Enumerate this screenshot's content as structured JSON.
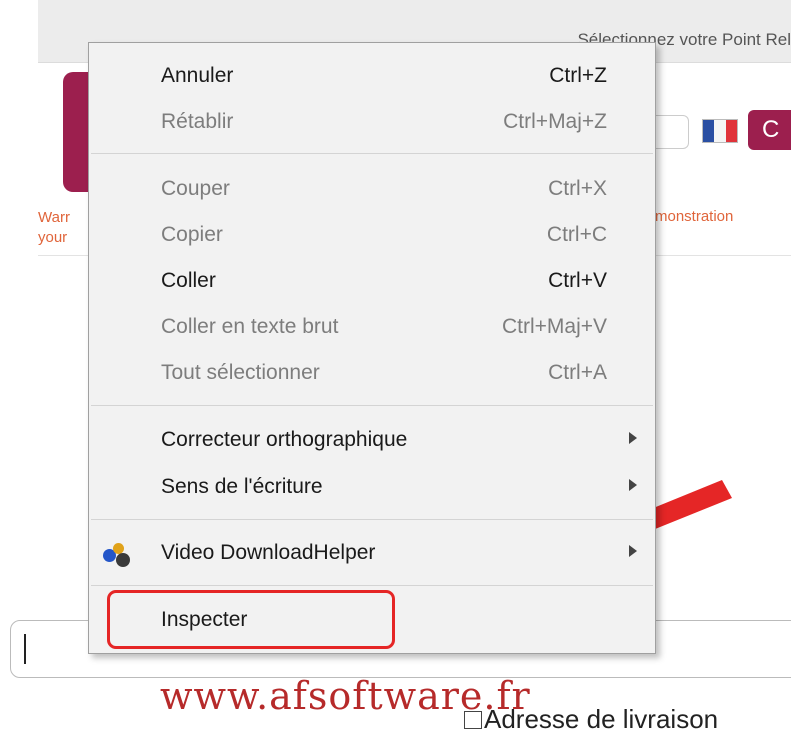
{
  "background_page": {
    "relay_header": "Sélectionnez votre Point Rel",
    "button_letter": "C",
    "warning_left": "Warr your",
    "warning_right": "monstration",
    "watermark": "www.afsoftware.fr",
    "delivery_checkbox_label": "Adresse de livraison"
  },
  "context_menu": {
    "undo": {
      "label": "Annuler",
      "shortcut": "Ctrl+Z"
    },
    "redo": {
      "label": "Rétablir",
      "shortcut": "Ctrl+Maj+Z"
    },
    "cut": {
      "label": "Couper",
      "shortcut": "Ctrl+X"
    },
    "copy": {
      "label": "Copier",
      "shortcut": "Ctrl+C"
    },
    "paste": {
      "label": "Coller",
      "shortcut": "Ctrl+V"
    },
    "paste_plain": {
      "label": "Coller en texte brut",
      "shortcut": "Ctrl+Maj+V"
    },
    "select_all": {
      "label": "Tout sélectionner",
      "shortcut": "Ctrl+A"
    },
    "spellcheck": {
      "label": "Correcteur orthographique"
    },
    "writing_direction": {
      "label": "Sens de l'écriture"
    },
    "video_downloadhelper": {
      "label": "Video DownloadHelper"
    },
    "inspect": {
      "label": "Inspecter"
    }
  },
  "colors": {
    "brand": "#9c1f4e",
    "annotation_red": "#e52626",
    "warning_orange": "#e0653b",
    "watermark_red": "#b62a2a"
  },
  "icons": {
    "video_downloadhelper": "video-downloadhelper-icon",
    "submenu": "chevron-right-icon",
    "flag": "french-flag-icon"
  }
}
